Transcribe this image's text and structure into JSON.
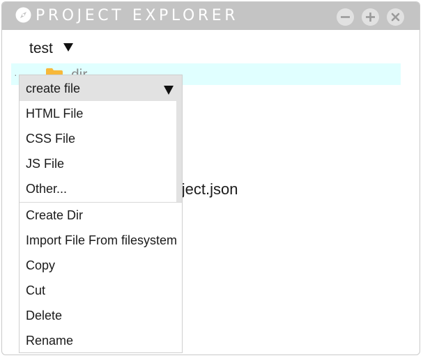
{
  "window": {
    "title": "PROJECT EXPLORER",
    "icon": "compass-icon",
    "controls": [
      "minimize-icon",
      "maximize-icon",
      "close-icon"
    ]
  },
  "tree": {
    "project_name": "test",
    "project_expand_icon": "caret-down-icon",
    "dir_label": "dir",
    "dir_icon": "folder-icon",
    "file_label": "project.json"
  },
  "context_menu": {
    "submenu": {
      "label": "create file",
      "caret_icon": "caret-down-icon",
      "items": [
        "HTML File",
        "CSS File",
        "JS File",
        "Other..."
      ]
    },
    "items": [
      "Create Dir",
      "Import File From filesystem",
      "Copy",
      "Cut",
      "Delete",
      "Rename"
    ]
  },
  "colors": {
    "titlebar": "#c4c4c4",
    "selected_row": "#e0ffff",
    "folder": "#f7b83a",
    "submenu_header": "#e2e2e2"
  }
}
